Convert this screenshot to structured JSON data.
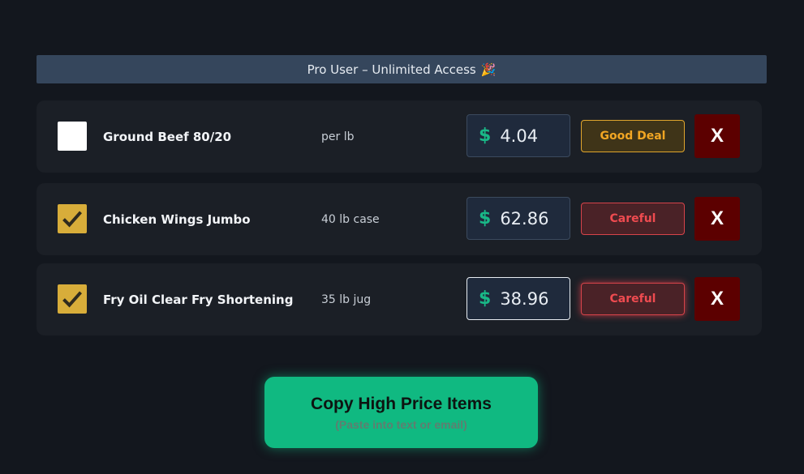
{
  "banner": {
    "text": "Pro User – Unlimited Access",
    "emoji": "🎉"
  },
  "items": [
    {
      "checked": false,
      "name": "Ground Beef 80/20",
      "unit": "per lb",
      "currency": "$",
      "price": "4.04",
      "status": "Good Deal",
      "delete_label": "X"
    },
    {
      "checked": true,
      "name": "Chicken Wings Jumbo",
      "unit": "40 lb case",
      "currency": "$",
      "price": "62.86",
      "status": "Careful",
      "delete_label": "X"
    },
    {
      "checked": true,
      "name": "Fry Oil Clear Fry Shortening",
      "unit": "35 lb jug",
      "currency": "$",
      "price": "38.96",
      "status": "Careful",
      "delete_label": "X"
    }
  ],
  "copy_button": {
    "title": "Copy High Price Items",
    "subtitle": "(Paste into text or email)"
  },
  "colors": {
    "background": "#13171e",
    "banner": "#35465c",
    "row": "#1b1f26",
    "accent_green": "#10b981",
    "checkbox_checked": "#d8ad3a",
    "good_deal": "#f2a623",
    "careful": "#ef4b50",
    "delete": "#5c0000"
  },
  "icons": {
    "checkmark": "checkmark-icon",
    "party": "party-popper-icon"
  }
}
